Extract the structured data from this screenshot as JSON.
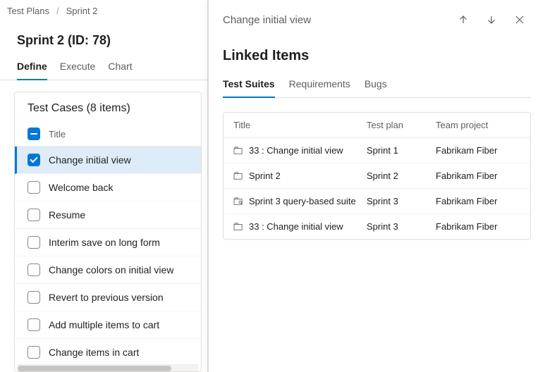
{
  "breadcrumb": {
    "items": [
      "Test Plans",
      "Sprint 2"
    ]
  },
  "page": {
    "title": "Sprint 2 (ID: 78)"
  },
  "tabs": [
    {
      "label": "Define",
      "active": true
    },
    {
      "label": "Execute",
      "active": false
    },
    {
      "label": "Chart",
      "active": false
    }
  ],
  "test_cases": {
    "heading": "Test Cases (8 items)",
    "column_title": "Title",
    "items": [
      {
        "title": "Change initial view",
        "checked": true
      },
      {
        "title": "Welcome back",
        "checked": false
      },
      {
        "title": "Resume",
        "checked": false
      },
      {
        "title": "Interim save on long form",
        "checked": false
      },
      {
        "title": "Change colors on initial view",
        "checked": false
      },
      {
        "title": "Revert to previous version",
        "checked": false
      },
      {
        "title": "Add multiple items to cart",
        "checked": false
      },
      {
        "title": "Change items in cart",
        "checked": false
      }
    ]
  },
  "side_panel": {
    "title": "Change initial view",
    "section_heading": "Linked Items",
    "tabs": [
      {
        "label": "Test Suites",
        "active": true
      },
      {
        "label": "Requirements",
        "active": false
      },
      {
        "label": "Bugs",
        "active": false
      }
    ],
    "columns": {
      "title": "Title",
      "plan": "Test plan",
      "project": "Team project"
    },
    "rows": [
      {
        "icon": "static",
        "title": "33 : Change initial view",
        "plan": "Sprint 1",
        "project": "Fabrikam Fiber"
      },
      {
        "icon": "static",
        "title": "Sprint 2",
        "plan": "Sprint 2",
        "project": "Fabrikam Fiber"
      },
      {
        "icon": "query",
        "title": "Sprint 3 query-based suite",
        "plan": "Sprint 3",
        "project": "Fabrikam Fiber"
      },
      {
        "icon": "static",
        "title": "33 : Change initial view",
        "plan": "Sprint 3",
        "project": "Fabrikam Fiber"
      }
    ]
  }
}
